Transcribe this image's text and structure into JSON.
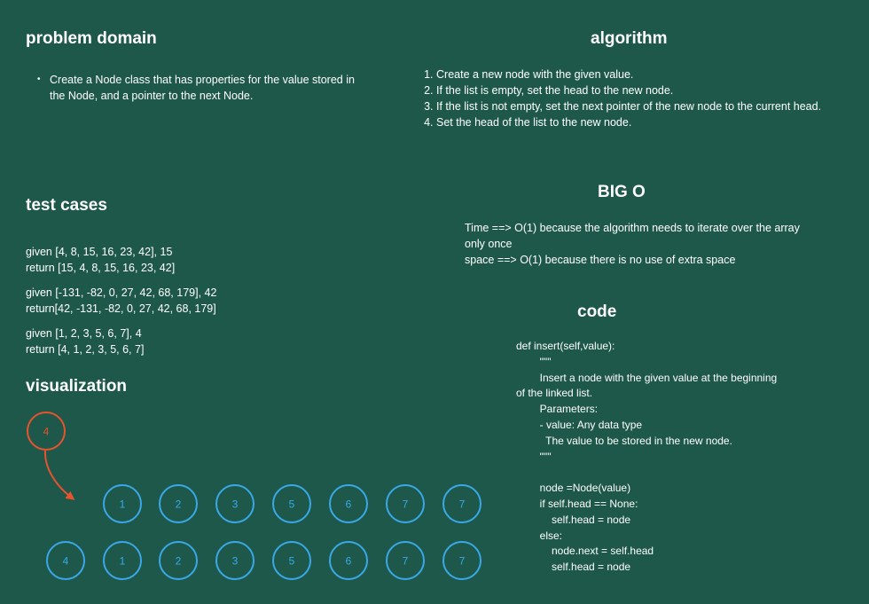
{
  "problem_domain": {
    "title": "problem domain",
    "bullet": "Create a Node class that has properties for the value stored in the Node, and a pointer to the next Node."
  },
  "algorithm": {
    "title": "algorithm",
    "steps": [
      "Create a new node with the given value.",
      "If the list is empty, set the head to the new node.",
      "If the list is not empty, set the next pointer of the new node to the current head.",
      "Set the head of the list to the new node."
    ]
  },
  "test_cases": {
    "title": "test cases",
    "cases": [
      {
        "given": "given [4, 8, 15, 16, 23, 42], 15",
        "return": "return [15, 4, 8, 15, 16, 23, 42]"
      },
      {
        "given": "given [-131, -82, 0, 27, 42, 68, 179], 42",
        "return": "return[42, -131, -82, 0, 27, 42, 68, 179]"
      },
      {
        "given": "given [1, 2, 3, 5, 6, 7], 4",
        "return": "return [4, 1, 2, 3, 5, 6, 7]"
      }
    ]
  },
  "big_o": {
    "title": "BIG O",
    "time": "Time ==> O(1) because the algorithm needs to iterate over the array only once",
    "space": "space ==> O(1) because there is no use of extra space"
  },
  "code": {
    "title": "code",
    "lines": [
      "def insert(self,value):",
      "        \"\"\"",
      "        Insert a node with the given value at the beginning",
      "of the linked list.",
      "        Parameters:",
      "        - value: Any data type",
      "          The value to be stored in the new node.",
      "        \"\"\"",
      "",
      "        node =Node(value)",
      "        if self.head == None:",
      "            self.head = node",
      "        else:",
      "            node.next = self.head",
      "            self.head = node"
    ]
  },
  "visualization": {
    "title": "visualization",
    "new_node": "4",
    "row1": [
      "1",
      "2",
      "3",
      "5",
      "6",
      "7",
      "7"
    ],
    "row2": [
      "4",
      "1",
      "2",
      "3",
      "5",
      "6",
      "7",
      "7"
    ]
  },
  "colors": {
    "background": "#1e584b",
    "node_stroke": "#3aa8e6",
    "new_node_stroke": "#e6532d",
    "arrow": "#e6532d"
  }
}
